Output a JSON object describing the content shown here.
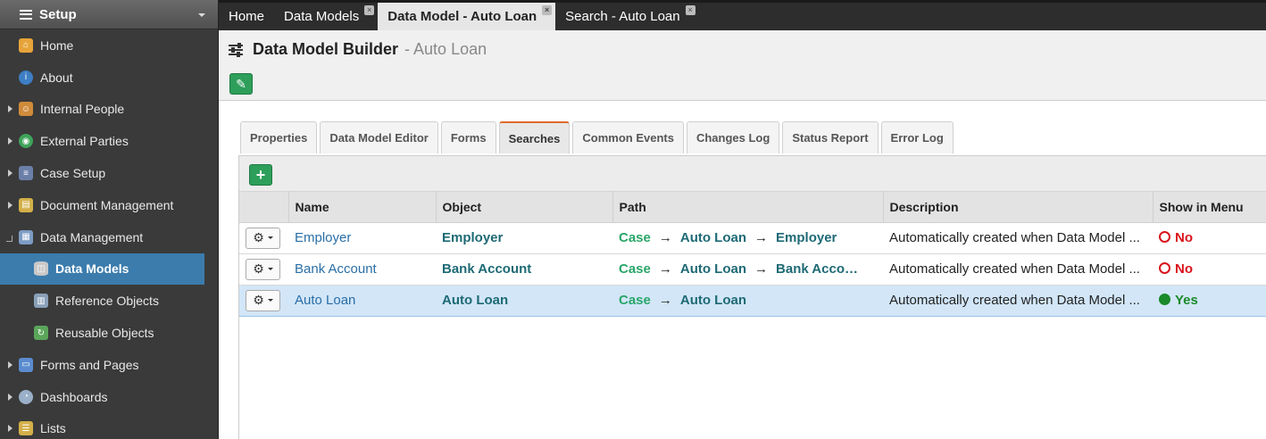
{
  "sidebar": {
    "title": "Setup",
    "items": [
      {
        "label": "Home",
        "icon": "home-icon",
        "color": "#e7a43a"
      },
      {
        "label": "About",
        "icon": "info-icon",
        "color": "#3d7ec4"
      },
      {
        "label": "Internal People",
        "icon": "people-icon",
        "color": "#d08b3b"
      },
      {
        "label": "External Parties",
        "icon": "globe-icon",
        "color": "#3ea35a"
      },
      {
        "label": "Case Setup",
        "icon": "case-setup-icon",
        "color": "#6b7fa8"
      },
      {
        "label": "Document Management",
        "icon": "document-icon",
        "color": "#d4b04a"
      },
      {
        "label": "Data Management",
        "icon": "data-management-icon",
        "color": "#7d9cc4"
      },
      {
        "label": "Data Models",
        "icon": "database-icon",
        "color": "#c8c8c8"
      },
      {
        "label": "Reference Objects",
        "icon": "reference-icon",
        "color": "#8aa0b8"
      },
      {
        "label": "Reusable Objects",
        "icon": "reusable-icon",
        "color": "#5aa55a"
      },
      {
        "label": "Forms and Pages",
        "icon": "forms-icon",
        "color": "#5b8ccf"
      },
      {
        "label": "Dashboards",
        "icon": "dashboard-icon",
        "color": "#9ab0c8"
      },
      {
        "label": "Lists",
        "icon": "list-icon",
        "color": "#d4b04a"
      }
    ]
  },
  "tabs": [
    {
      "label": "Home"
    },
    {
      "label": "Data Models"
    },
    {
      "label": "Data Model - Auto Loan"
    },
    {
      "label": "Search - Auto Loan"
    }
  ],
  "header": {
    "title": "Data Model Builder",
    "subtitle": "- Auto Loan"
  },
  "content_tabs": [
    "Properties",
    "Data Model Editor",
    "Forms",
    "Searches",
    "Common Events",
    "Changes Log",
    "Status Report",
    "Error Log"
  ],
  "table": {
    "columns": [
      "",
      "Name",
      "Object",
      "Path",
      "Description",
      "Show in Menu"
    ],
    "rows": [
      {
        "name": "Employer",
        "object": "Employer",
        "path_start": "Case",
        "path_mid": "Auto Loan",
        "path_end": "Employer",
        "description": "Automatically created when Data Model ...",
        "show": "No"
      },
      {
        "name": "Bank Account",
        "object": "Bank Account",
        "path_start": "Case",
        "path_mid": "Auto Loan",
        "path_end": "Bank Acco…",
        "description": "Automatically created when Data Model ...",
        "show": "No"
      },
      {
        "name": "Auto Loan",
        "object": "Auto Loan",
        "path_start": "Case",
        "path_mid": "Auto Loan",
        "path_end": "",
        "description": "Automatically created when Data Model ...",
        "show": "Yes"
      }
    ]
  },
  "arrow_glyph": "→"
}
